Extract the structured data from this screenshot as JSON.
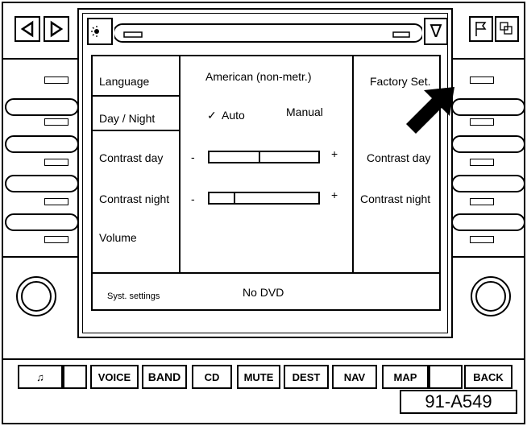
{
  "top_left": {
    "prev_symbol": "◁",
    "next_symbol": "▷"
  },
  "top_bar": {
    "day_night_icon": "sun-moon-icon",
    "dropdown_symbol": "∇"
  },
  "top_right": {
    "flag_icon": "flag-icon",
    "rotate_icon": "rotate-icon"
  },
  "settings": {
    "rows": [
      {
        "label": "Language"
      },
      {
        "label": "Day / Night"
      },
      {
        "label": "Contrast day"
      },
      {
        "label": "Contrast night"
      },
      {
        "label": "Volume"
      }
    ],
    "language_value": "American (non-metr.)",
    "factory_label": "Factory Set.",
    "auto_check": "✓",
    "auto_label": "Auto",
    "manual_label": "Manual",
    "minus": "-",
    "plus": "+",
    "contrast_day_right": "Contrast day",
    "contrast_night_right": "Contrast night",
    "contrast_day_level": 0.45,
    "contrast_night_level": 0.22
  },
  "status": {
    "left": "Syst. settings",
    "center": "No DVD"
  },
  "bottom_buttons": [
    {
      "label": "♫"
    },
    {
      "label": ""
    },
    {
      "label": "VOICE"
    },
    {
      "label": "BAND"
    },
    {
      "label": "CD"
    },
    {
      "label": "MUTE"
    },
    {
      "label": "DEST"
    },
    {
      "label": "NAV"
    },
    {
      "label": "MAP"
    },
    {
      "label": ""
    },
    {
      "label": "BACK"
    }
  ],
  "figure_id": "91-A549"
}
